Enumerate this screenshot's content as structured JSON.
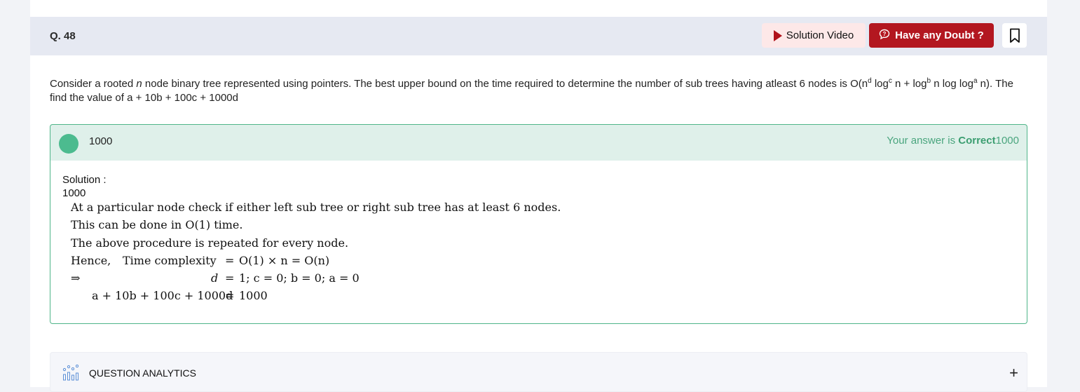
{
  "question": {
    "number": "Q. 48",
    "text_parts": {
      "p1": "Consider a rooted ",
      "var_n": "n",
      "p2": " node binary tree represented using pointers. The best upper bound on the time required to determine the number of sub trees having atleast 6 nodes is O(n",
      "sup_d": "d",
      "p3": " log",
      "sup_c": "c",
      "p4": " n + log",
      "sup_b": "b",
      "p5": " n log log",
      "sup_a": "a",
      "p6": " n). The find the value of a + 10b + 100c + 1000d"
    }
  },
  "header": {
    "solution_video_label": "Solution Video",
    "doubt_label": "Have any Doubt ?"
  },
  "answer": {
    "value": "1000",
    "status_prefix": "Your answer is ",
    "status_word": "Correct",
    "status_value": "1000"
  },
  "solution": {
    "label": "Solution :",
    "answer": "1000",
    "lines": {
      "l1": "At a particular node check if either left sub tree or right sub tree has at least 6 nodes.",
      "l2": "This can be done in O(1) time.",
      "l3": "The above procedure is repeated for every node.",
      "l4a": "Hence,",
      "l4b": "Time complexity",
      "l4eq": "=",
      "l4c": "O(1) × n = O(n)",
      "l5a": "⇒",
      "l5b": "d",
      "l5eq": "=",
      "l5c": "1;  c = 0;  b = 0;  a = 0",
      "l6b": "a + 10b + 100c + 1000d",
      "l6eq": "=",
      "l6c": "1000"
    }
  },
  "analytics": {
    "label": "QUESTION ANALYTICS",
    "expand": "+"
  },
  "colors": {
    "accent_red": "#b31720",
    "correct_green": "#4cbb8f",
    "header_bg": "#e6e9f2"
  }
}
